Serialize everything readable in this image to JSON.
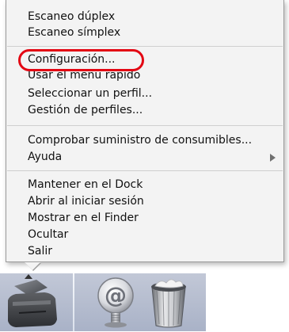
{
  "menu": {
    "groups": [
      {
        "items": [
          {
            "label": "Escaneo dúplex"
          },
          {
            "label": "Escaneo símplex"
          }
        ]
      },
      {
        "items": [
          {
            "label": "Configuración...",
            "highlighted": true
          },
          {
            "label": "Usar el menú rápido"
          },
          {
            "label": "Seleccionar un perfil..."
          },
          {
            "label": "Gestión de perfiles..."
          }
        ]
      },
      {
        "items": [
          {
            "label": "Comprobar suministro de consumibles..."
          },
          {
            "label": "Ayuda",
            "has_submenu": true
          }
        ]
      },
      {
        "items": [
          {
            "label": "Mantener en el Dock"
          },
          {
            "label": "Abrir al iniciar sesión"
          },
          {
            "label": "Mostrar en el Finder"
          },
          {
            "label": "Ocultar"
          },
          {
            "label": "Salir"
          }
        ]
      }
    ]
  },
  "annotation": {
    "highlight_color": "#e30613"
  },
  "dock": {
    "icons": [
      {
        "name": "scanner-app-icon"
      },
      {
        "name": "mail-app-icon"
      },
      {
        "name": "trash-icon"
      }
    ]
  },
  "colors": {
    "menu_background": "#f3f3f3",
    "dock_background": "#b7bfd1"
  }
}
